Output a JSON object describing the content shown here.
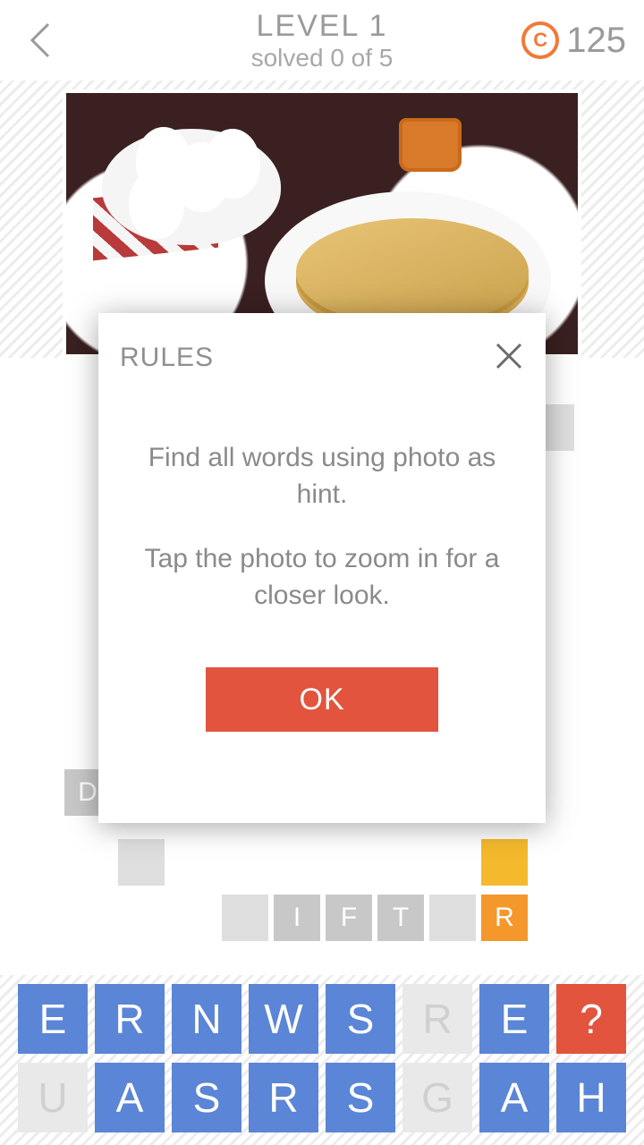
{
  "header": {
    "level_label": "LEVEL 1",
    "solved_label": "solved 0 of 5",
    "coin_glyph": "C",
    "coins": "125"
  },
  "slots": {
    "d_label": "D",
    "row_letters": [
      "",
      "I",
      "F",
      "T",
      "",
      "R"
    ]
  },
  "bank": {
    "row1": [
      "E",
      "R",
      "N",
      "W",
      "S",
      "R",
      "E",
      "?"
    ],
    "row2": [
      "U",
      "A",
      "S",
      "R",
      "S",
      "G",
      "A",
      "H"
    ],
    "row1_style": [
      "blue",
      "blue",
      "blue",
      "blue",
      "blue",
      "ghost",
      "blue",
      "red"
    ],
    "row2_style": [
      "ghost",
      "blue",
      "blue",
      "blue",
      "blue",
      "ghost",
      "blue",
      "blue"
    ]
  },
  "modal": {
    "title": "RULES",
    "line1": "Find all words using photo as hint.",
    "line2": "Tap the photo to zoom in for a closer look.",
    "ok": "OK"
  }
}
